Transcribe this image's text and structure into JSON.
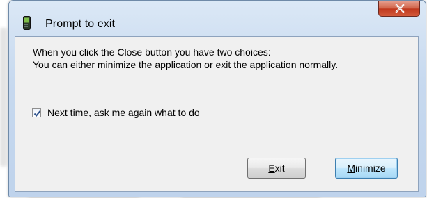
{
  "window": {
    "title": "Prompt to exit",
    "close_label": "X"
  },
  "message": {
    "line1": "When you click the Close button you have two choices:",
    "line2": "You can either minimize the application or exit the application normally."
  },
  "ask_again": {
    "label": "Next time, ask me again what to do",
    "checked": true
  },
  "buttons": {
    "exit_label": "Exit",
    "minimize_label": "Minimize",
    "default": "minimize"
  },
  "icons": {
    "app": "phone-app-icon",
    "close": "close-icon",
    "check": "checkmark-icon"
  },
  "colors": {
    "title_bar": "#c7d9ef",
    "close_button": "#c0391e",
    "default_button_border": "#3c7fb1"
  }
}
